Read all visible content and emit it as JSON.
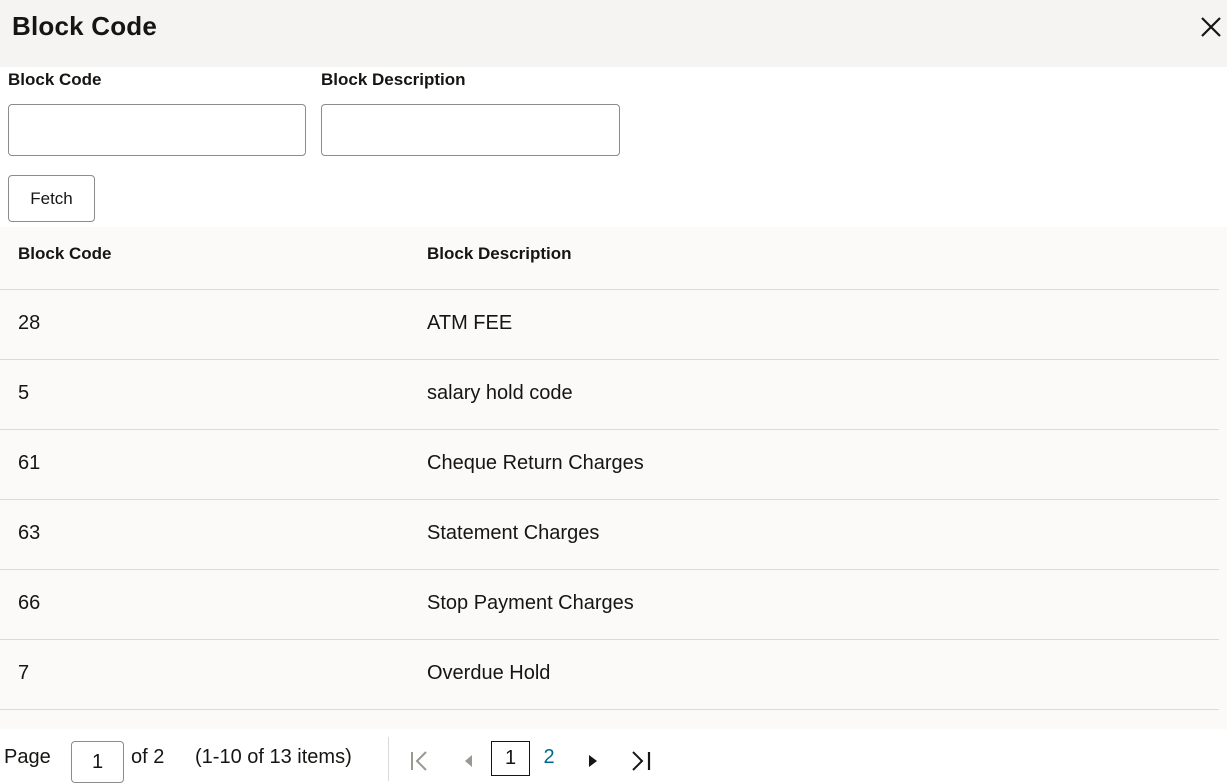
{
  "dialog": {
    "title": "Block Code"
  },
  "form": {
    "code_label": "Block Code",
    "description_label": "Block Description",
    "code_value": "",
    "description_value": "",
    "fetch_label": "Fetch"
  },
  "table": {
    "columns": [
      "Block Code",
      "Block Description"
    ],
    "rows": [
      {
        "code": "28",
        "description": "ATM FEE"
      },
      {
        "code": "5",
        "description": "salary hold code"
      },
      {
        "code": "61",
        "description": "Cheque Return Charges"
      },
      {
        "code": "63",
        "description": "Statement Charges"
      },
      {
        "code": "66",
        "description": "Stop Payment Charges"
      },
      {
        "code": "7",
        "description": "Overdue Hold"
      }
    ]
  },
  "pagination": {
    "page_label": "Page",
    "current_page": "1",
    "of_label": "of 2",
    "items_summary": "(1-10 of 13 items)",
    "pages": [
      "1",
      "2"
    ],
    "link_color": "#00688c"
  }
}
